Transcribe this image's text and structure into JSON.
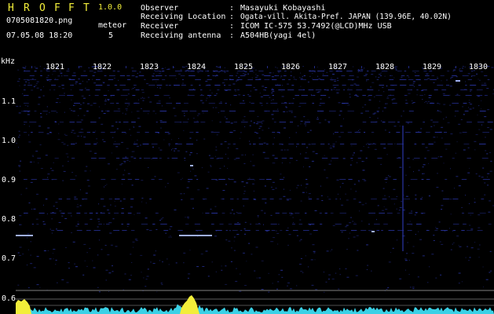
{
  "app": {
    "name_letters": [
      "H",
      "R",
      "O",
      "F",
      "F",
      "T"
    ],
    "version": "1.0.0",
    "filename": "0705081820.png",
    "datetime": "07.05.08 18:20",
    "meteor_label": "meteor",
    "meteor_count": "5"
  },
  "station": {
    "rows": [
      {
        "label": "Observer",
        "sep": ":",
        "value": "Masayuki Kobayashi"
      },
      {
        "label": "Receiving Location",
        "sep": ":",
        "value": "Ogata-vill. Akita-Pref. JAPAN (139.96E, 40.02N)"
      },
      {
        "label": "Receiver",
        "sep": ":",
        "value": "ICOM IC-575 53.7492(@LCD)MHz USB"
      },
      {
        "label": "Receiving antenna",
        "sep": ":",
        "value": "A504HB(yagi 4el)"
      }
    ]
  },
  "axes": {
    "y_unit": "kHz",
    "y_ticks": [
      "1.1",
      "1.0",
      "0.9",
      "0.8",
      "0.7",
      "0.6"
    ],
    "x_ticks": [
      "1821",
      "1822",
      "1823",
      "1824",
      "1825",
      "1826",
      "1827",
      "1828",
      "1829",
      "1830"
    ]
  },
  "colors": {
    "title": "#f2ee3a",
    "text": "#ffffff",
    "background": "#000000",
    "noise": "#2a36a8",
    "signal": "#a8b8ff",
    "level": "#40e8ff",
    "peak": "#f2ee3a"
  }
}
